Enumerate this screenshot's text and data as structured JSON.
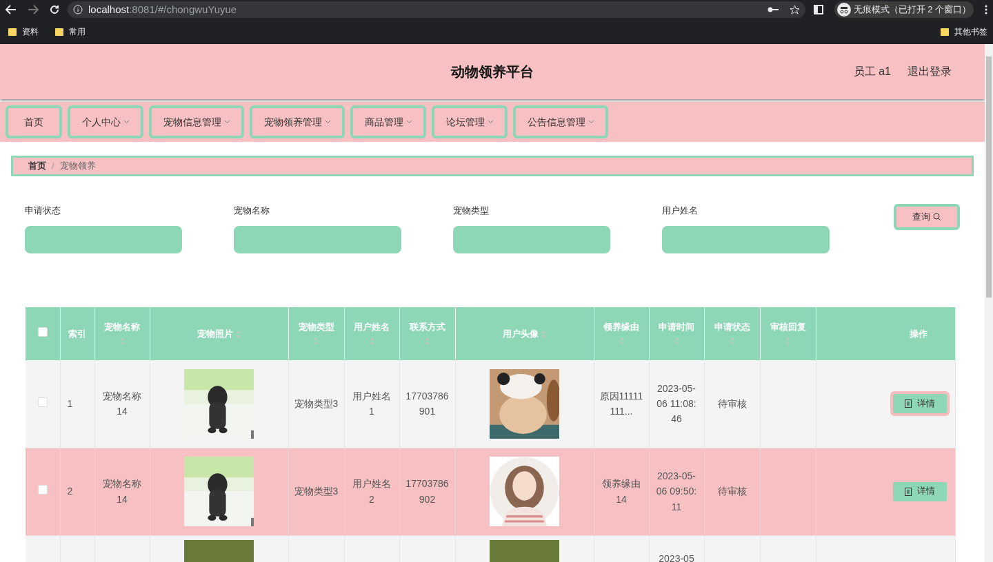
{
  "browser": {
    "url_host": "localhost",
    "url_rest": ":8081/#/chongwuYuyue",
    "incognito": "无痕模式（已打开 2 个窗口）",
    "bookmarks": [
      "资料",
      "常用"
    ],
    "other_bookmarks": "其他书签"
  },
  "header": {
    "title": "动物领养平台",
    "user": "员工 a1",
    "logout": "退出登录"
  },
  "nav": [
    {
      "label": "首页",
      "dropdown": false
    },
    {
      "label": "个人中心",
      "dropdown": true
    },
    {
      "label": "宠物信息管理",
      "dropdown": true
    },
    {
      "label": "宠物领养管理",
      "dropdown": true
    },
    {
      "label": "商品管理",
      "dropdown": true
    },
    {
      "label": "论坛管理",
      "dropdown": true
    },
    {
      "label": "公告信息管理",
      "dropdown": true
    }
  ],
  "breadcrumb": [
    "首页",
    "宠物领养"
  ],
  "breadcrumb_separator": "/",
  "filters": [
    {
      "label": "申请状态"
    },
    {
      "label": "宠物名称"
    },
    {
      "label": "宠物类型"
    },
    {
      "label": "用户姓名"
    }
  ],
  "search_button": "查询",
  "table": {
    "select_all_checked": false,
    "columns": [
      {
        "kind": "text",
        "label": "索引",
        "sortable": false
      },
      {
        "kind": "text",
        "label": "宠物名称",
        "sortable": true
      },
      {
        "label": "宠物照片",
        "sortable": true
      },
      {
        "kind": "text",
        "label": "宠物类型",
        "sortable": true
      },
      {
        "kind": "text",
        "label": "用户姓名",
        "sortable": true
      },
      {
        "kind": "text",
        "label": "联系方式",
        "sortable": true
      },
      {
        "label": "用户头像",
        "sortable": true
      },
      {
        "kind": "text",
        "label": "领养缘由",
        "sortable": true
      },
      {
        "kind": "text",
        "label": "申请时间",
        "sortable": true
      },
      {
        "kind": "text",
        "label": "申请状态",
        "sortable": true
      },
      {
        "kind": "text",
        "label": "审核回复",
        "sortable": true
      },
      {
        "kind": "action",
        "label": "操作",
        "sortable": false
      }
    ],
    "rows": [
      {
        "checked": false,
        "highlighted": false,
        "cells": [
          "1",
          "宠物名称14",
          "",
          "宠物类型3",
          "用户姓名1",
          "17703786901",
          "",
          "原因11111111...",
          "2023-05-06 11:08:46",
          "待审核",
          ""
        ],
        "detail_button": "详情",
        "focused": true
      },
      {
        "checked": false,
        "highlighted": true,
        "cells": [
          "2",
          "宠物名称14",
          "",
          "宠物类型3",
          "用户姓名2",
          "17703786902",
          "",
          "领养缘由14",
          "2023-05-06 09:50:11",
          "待审核",
          ""
        ],
        "detail_button": "详情",
        "focused": false
      },
      {
        "highlighted": false,
        "cells": [
          "",
          "",
          "",
          "",
          "",
          "",
          "",
          "",
          "2023-05",
          "",
          ""
        ]
      }
    ]
  }
}
